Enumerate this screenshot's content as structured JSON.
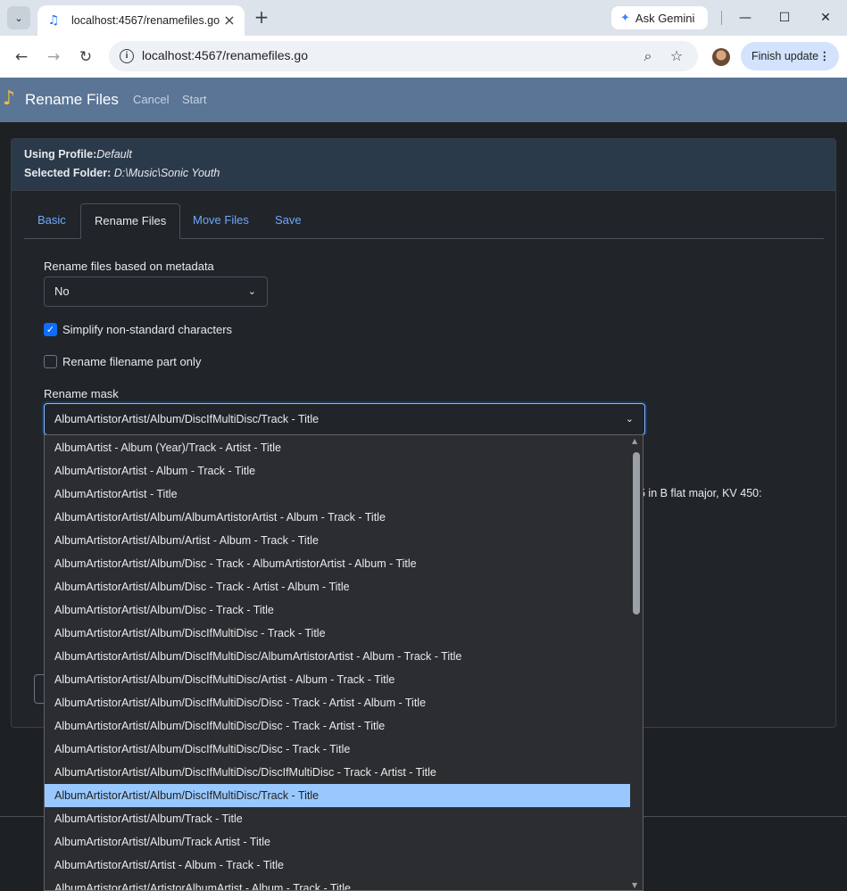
{
  "browser": {
    "tab_title": "localhost:4567/renamefiles.go",
    "url": "localhost:4567/renamefiles.go",
    "gemini_label": "Ask Gemini",
    "finish_update_label": "Finish update"
  },
  "app": {
    "title": "Rename Files",
    "nav": {
      "cancel": "Cancel",
      "start": "Start"
    }
  },
  "profile": {
    "profile_label": "Using Profile:",
    "profile_value": "Default",
    "folder_label": "Selected Folder:",
    "folder_value": "D:\\Music\\Sonic Youth"
  },
  "tabs": [
    {
      "label": "Basic"
    },
    {
      "label": "Rename Files"
    },
    {
      "label": "Move Files"
    },
    {
      "label": "Save"
    }
  ],
  "form": {
    "metadata_label": "Rename files based on metadata",
    "metadata_value": "No",
    "simplify_label": "Simplify non-standard characters",
    "simplify_checked": true,
    "filename_only_label": "Rename filename part only",
    "filename_only_checked": false,
    "mask_label": "Rename mask",
    "mask_value": "AlbumArtistorArtist/Album/DiscIfMultiDisc/Track - Title",
    "behind_text": "5 in B flat major, KV 450:"
  },
  "dropdown": {
    "options": [
      "AlbumArtist - Album (Year)/Track - Artist - Title",
      "AlbumArtistorArtist - Album - Track - Title",
      "AlbumArtistorArtist - Title",
      "AlbumArtistorArtist/Album/AlbumArtistorArtist - Album - Track - Title",
      "AlbumArtistorArtist/Album/Artist - Album - Track - Title",
      "AlbumArtistorArtist/Album/Disc - Track - AlbumArtistorArtist - Album - Title",
      "AlbumArtistorArtist/Album/Disc - Track - Artist - Album - Title",
      "AlbumArtistorArtist/Album/Disc - Track - Title",
      "AlbumArtistorArtist/Album/DiscIfMultiDisc - Track - Title",
      "AlbumArtistorArtist/Album/DiscIfMultiDisc/AlbumArtistorArtist - Album - Track - Title",
      "AlbumArtistorArtist/Album/DiscIfMultiDisc/Artist - Album - Track - Title",
      "AlbumArtistorArtist/Album/DiscIfMultiDisc/Disc - Track - Artist - Album - Title",
      "AlbumArtistorArtist/Album/DiscIfMultiDisc/Disc - Track - Artist - Title",
      "AlbumArtistorArtist/Album/DiscIfMultiDisc/Disc - Track - Title",
      "AlbumArtistorArtist/Album/DiscIfMultiDisc/DiscIfMultiDisc - Track - Artist - Title",
      "AlbumArtistorArtist/Album/DiscIfMultiDisc/Track - Title",
      "AlbumArtistorArtist/Album/Track - Title",
      "AlbumArtistorArtist/Album/Track Artist - Title",
      "AlbumArtistorArtist/Artist - Album - Track - Title",
      "AlbumArtistorArtist/ArtistorAlbumArtist - Album - Track - Title"
    ],
    "selected_index": 15
  },
  "colors": {
    "header_bg": "#5b7596",
    "accent": "#0d6efd",
    "link": "#6ea8fe",
    "selected_option": "#99c8ff"
  },
  "icons": {
    "tab_favicon": "music-note-icon",
    "app_logo": "music-note-icon",
    "gemini": "sparkle-icon"
  }
}
